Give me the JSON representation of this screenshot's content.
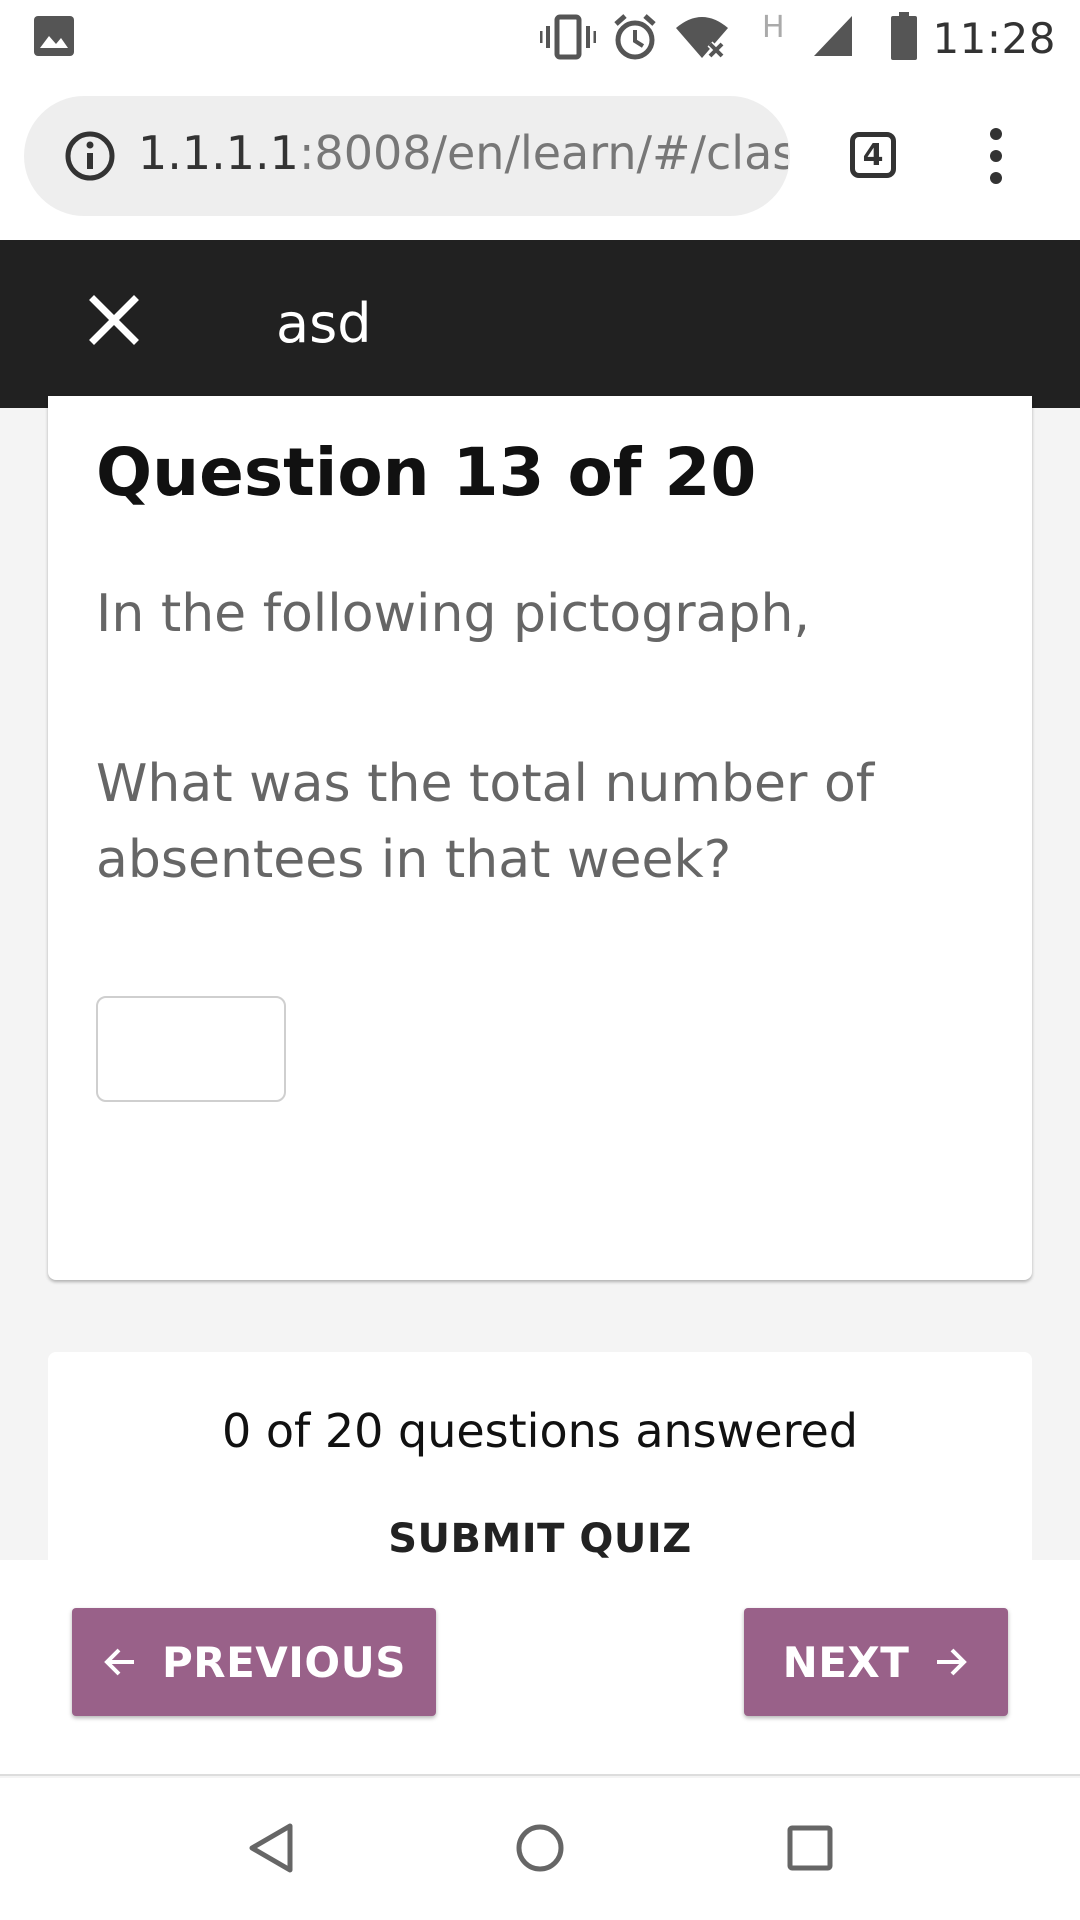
{
  "status_bar": {
    "time": "11:28",
    "network_label": "H",
    "icons": [
      "gallery-icon",
      "vibrate-icon",
      "alarm-icon",
      "wifi-off-icon",
      "signal-icon",
      "battery-icon"
    ]
  },
  "browser": {
    "url_host": "1.1.1.1",
    "url_path": ":8008/en/learn/#/clas",
    "tab_count": "4"
  },
  "header": {
    "title": "asd"
  },
  "question": {
    "title": "Question 13 of 20",
    "line1": "In the following pictograph,",
    "line2": "What was the total number of absentees in that week?",
    "answer_value": ""
  },
  "summary": {
    "answered_text": "0 of 20 questions answered",
    "submit_label": "SUBMIT QUIZ"
  },
  "nav": {
    "previous_label": "PREVIOUS",
    "next_label": "NEXT"
  },
  "colors": {
    "accent": "#996189",
    "header_bg": "#212121",
    "page_bg": "#f4f4f4"
  }
}
